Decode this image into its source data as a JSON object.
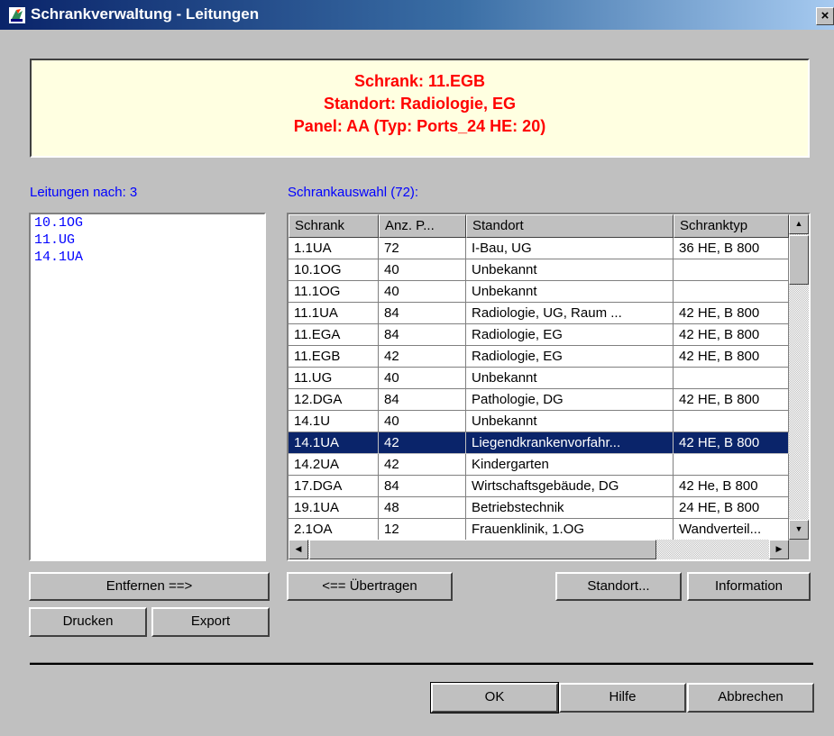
{
  "window": {
    "title": "Schrankverwaltung - Leitungen",
    "close_label": "×"
  },
  "info": {
    "line1": "Schrank: 11.EGB",
    "line2": "Standort: Radiologie, EG",
    "line3": "Panel: AA (Typ: Ports_24  HE: 20)",
    "color": "#ff0000"
  },
  "leitungen": {
    "label": "Leitungen nach: 3",
    "items": [
      "10.1OG",
      "11.UG",
      "14.1UA"
    ]
  },
  "schrankauswahl": {
    "label": "Schrankauswahl (72):",
    "columns": [
      "Schrank",
      "Anz. P...",
      "Standort",
      "Schranktyp"
    ],
    "rows": [
      [
        "1.1UA",
        "72",
        "I-Bau, UG",
        "36 HE, B 800"
      ],
      [
        "10.1OG",
        "40",
        "Unbekannt",
        ""
      ],
      [
        "11.1OG",
        "40",
        "Unbekannt",
        ""
      ],
      [
        "11.1UA",
        "84",
        "Radiologie, UG, Raum ...",
        "42 HE, B 800"
      ],
      [
        "11.EGA",
        "84",
        "Radiologie, EG",
        "42 HE, B 800"
      ],
      [
        "11.EGB",
        "42",
        "Radiologie, EG",
        "42 HE, B 800"
      ],
      [
        "11.UG",
        "40",
        "Unbekannt",
        ""
      ],
      [
        "12.DGA",
        "84",
        "Pathologie, DG",
        "42 HE, B 800"
      ],
      [
        "14.1U",
        "40",
        "Unbekannt",
        ""
      ],
      [
        "14.1UA",
        "42",
        "Liegendkrankenvorfahr...",
        "42 HE, B 800"
      ],
      [
        "14.2UA",
        "42",
        "Kindergarten",
        ""
      ],
      [
        "17.DGA",
        "84",
        "Wirtschaftsgebäude, DG",
        "42 He, B 800"
      ],
      [
        "19.1UA",
        "48",
        "Betriebstechnik",
        "24 HE, B 800"
      ],
      [
        "2.1OA",
        "12",
        "Frauenklinik, 1.OG",
        "Wandverteil..."
      ]
    ],
    "selected_row": "14.1UA",
    "selection_color": "#0a246a"
  },
  "buttons": {
    "entfernen": "Entfernen ==>",
    "uebertragen": "<== Übertragen",
    "standort": "Standort...",
    "information": "Information",
    "drucken": "Drucken",
    "export": "Export",
    "ok": "OK",
    "hilfe": "Hilfe",
    "abbrechen": "Abbrechen"
  },
  "icons": {
    "app": "app-icon",
    "scroll_up": "▲",
    "scroll_down": "▼",
    "scroll_left": "◀",
    "scroll_right": "▶"
  }
}
